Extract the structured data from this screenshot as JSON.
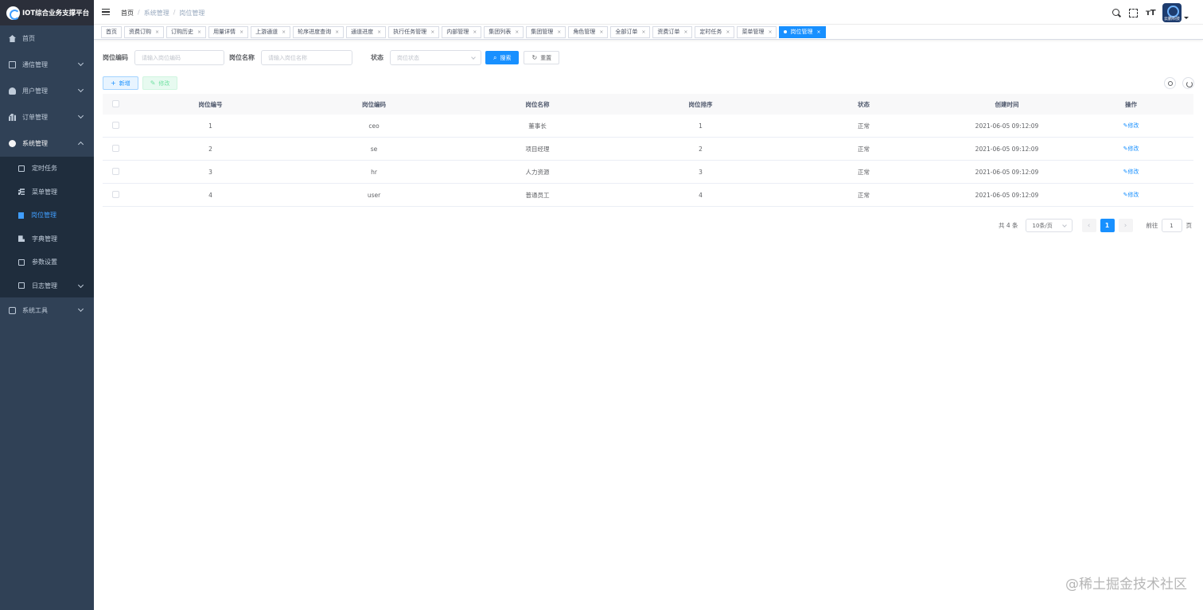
{
  "app": {
    "title": "IOT综合业务支撑平台"
  },
  "sidebar": {
    "items": [
      {
        "label": "首页"
      },
      {
        "label": "通信管理"
      },
      {
        "label": "用户管理"
      },
      {
        "label": "订单管理"
      },
      {
        "label": "系统管理"
      },
      {
        "label": "系统工具"
      }
    ],
    "sub_items": [
      {
        "label": "定时任务"
      },
      {
        "label": "菜单管理"
      },
      {
        "label": "岗位管理"
      },
      {
        "label": "字典管理"
      },
      {
        "label": "参数设置"
      },
      {
        "label": "日志管理"
      }
    ]
  },
  "header": {
    "breadcrumb": [
      "首页",
      "系统管理",
      "岗位管理"
    ],
    "separator": "/",
    "avatar_text": "云鹏科技",
    "size_icon_text": "ᴛT"
  },
  "tags": [
    "首页",
    "资费订购",
    "订购历史",
    "用量详情",
    "上游通道",
    "轮序进度查询",
    "通道进度",
    "执行任务管理",
    "内部管理",
    "集团列表",
    "集团管理",
    "角色管理",
    "全部订单",
    "资费订单",
    "定时任务",
    "菜单管理",
    "岗位管理"
  ],
  "tag_close": "×",
  "search": {
    "code_label": "岗位编码",
    "code_placeholder": "请输入岗位编码",
    "name_label": "岗位名称",
    "name_placeholder": "请输入岗位名称",
    "status_label": "状态",
    "status_placeholder": "岗位状态",
    "search_btn": "搜索",
    "reset_btn": "重置"
  },
  "toolbar": {
    "add_label": "新增",
    "edit_label": "修改",
    "add_icon": "+",
    "edit_icon": "✎"
  },
  "table": {
    "columns": [
      "岗位编号",
      "岗位编码",
      "岗位名称",
      "岗位排序",
      "状态",
      "创建时间",
      "操作"
    ],
    "rows": [
      {
        "id": "1",
        "code": "ceo",
        "name": "董事长",
        "sort": "1",
        "status": "正常",
        "created": "2021-06-05 09:12:09",
        "action": "修改"
      },
      {
        "id": "2",
        "code": "se",
        "name": "项目经理",
        "sort": "2",
        "status": "正常",
        "created": "2021-06-05 09:12:09",
        "action": "修改"
      },
      {
        "id": "3",
        "code": "hr",
        "name": "人力资源",
        "sort": "3",
        "status": "正常",
        "created": "2021-06-05 09:12:09",
        "action": "修改"
      },
      {
        "id": "4",
        "code": "user",
        "name": "普通员工",
        "sort": "4",
        "status": "正常",
        "created": "2021-06-05 09:12:09",
        "action": "修改"
      }
    ]
  },
  "pagination": {
    "total": "共 4 条",
    "page_size": "10条/页",
    "current": "1",
    "goto_label": "前往",
    "goto_value": "1",
    "page_suffix": "页",
    "prev": "‹",
    "next": "›"
  },
  "watermark": "@稀土掘金技术社区",
  "colors": {
    "sidebar_bg": "#304156",
    "submenu_bg": "#1f2d3d",
    "accent": "#1890ff"
  }
}
